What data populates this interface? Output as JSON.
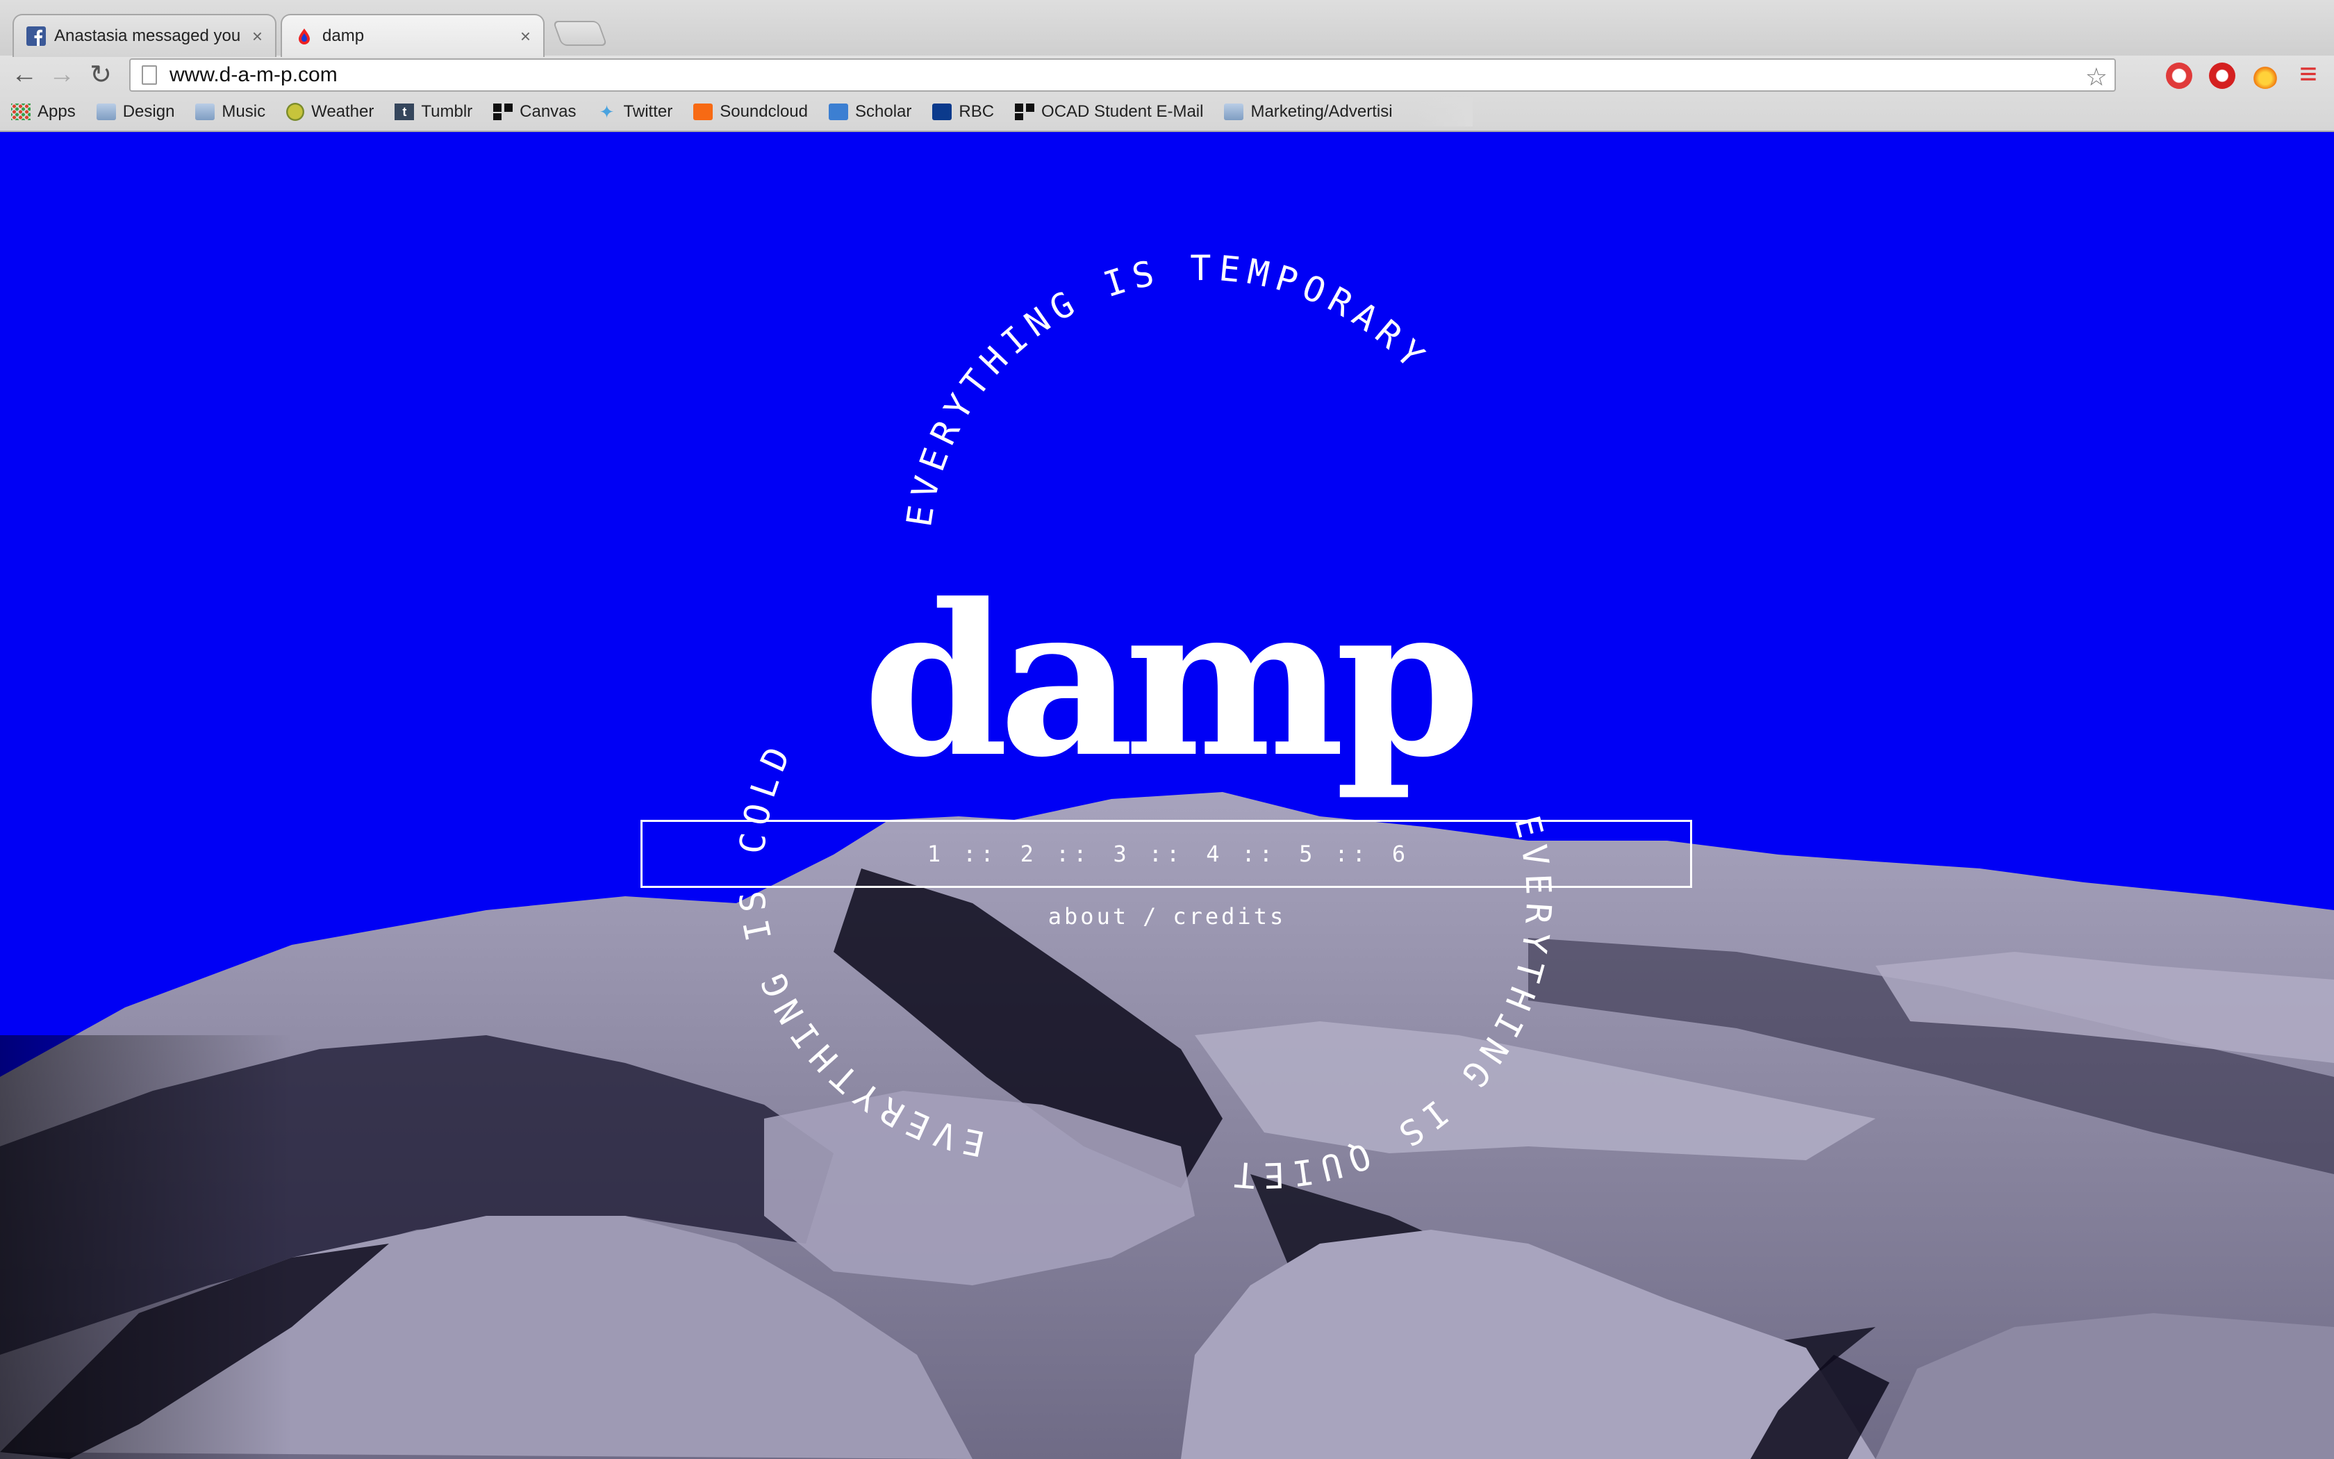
{
  "tabs": [
    {
      "title": "Anastasia messaged you",
      "icon": "facebook-icon",
      "close": "×"
    },
    {
      "title": "damp",
      "icon": "damp-drop-icon",
      "close": "×"
    }
  ],
  "toolbar": {
    "back": "←",
    "forward": "→",
    "reload": "↻",
    "url": "www.d-a-m-p.com",
    "star": "☆",
    "menu": "≡"
  },
  "bookmarks": [
    {
      "label": "Apps",
      "icon": "apps-grid-icon"
    },
    {
      "label": "Design",
      "icon": "folder-icon"
    },
    {
      "label": "Music",
      "icon": "folder-icon"
    },
    {
      "label": "Weather",
      "icon": "weather-icon"
    },
    {
      "label": "Tumblr",
      "icon": "tumblr-icon"
    },
    {
      "label": "Canvas",
      "icon": "canvas-icon"
    },
    {
      "label": "Twitter",
      "icon": "twitter-icon"
    },
    {
      "label": "Soundcloud",
      "icon": "soundcloud-icon"
    },
    {
      "label": "Scholar",
      "icon": "scholar-icon"
    },
    {
      "label": "RBC",
      "icon": "rbc-icon"
    },
    {
      "label": "OCAD Student E-Mail",
      "icon": "ocad-icon"
    },
    {
      "label": "Marketing/Advertisi",
      "icon": "folder-icon"
    }
  ],
  "page": {
    "logo": "damp",
    "phrase_top": "EVERYTHING IS TEMPORARY",
    "phrase_left": "EVERYTHING IS COLD",
    "phrase_right": "EVERYTHING IS QUIET",
    "chapters": [
      "1",
      "2",
      "3",
      "4",
      "5",
      "6"
    ],
    "chapter_separator": "::",
    "about": "about",
    "slash": "/",
    "credits": "credits",
    "background_color": "#0000f5",
    "terrain_color": "#8f8aa6"
  }
}
